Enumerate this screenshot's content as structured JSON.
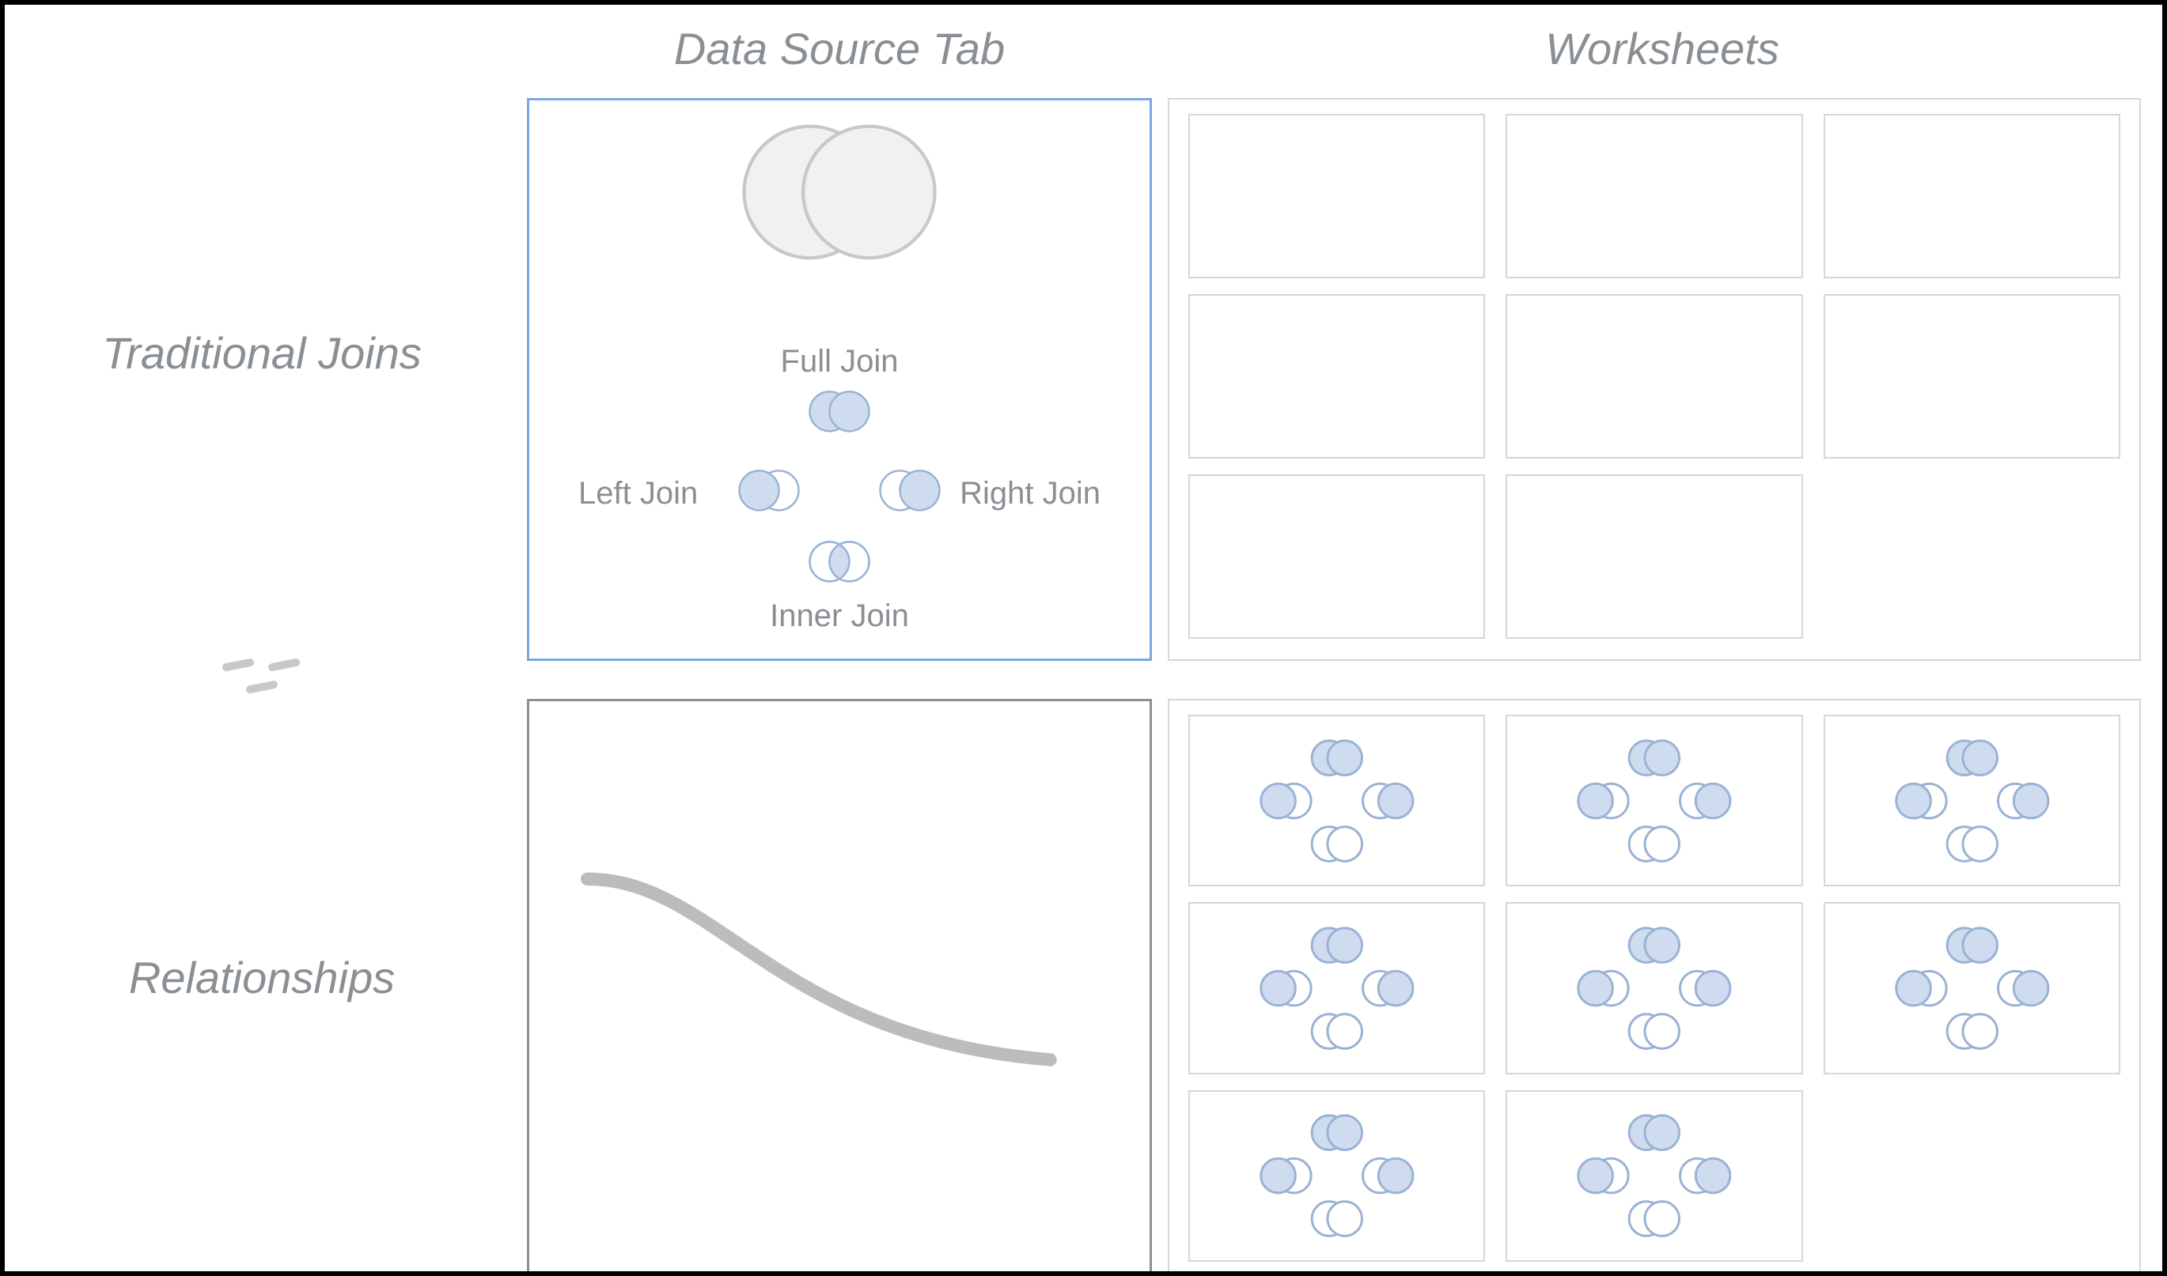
{
  "headers": {
    "data_source": "Data Source Tab",
    "worksheets": "Worksheets"
  },
  "rows": {
    "traditional_joins": "Traditional Joins",
    "relationships": "Relationships"
  },
  "joins": {
    "full": "Full Join",
    "left": "Left Join",
    "right": "Right Join",
    "inner": "Inner Join"
  },
  "worksheet_grid": {
    "top_rows": 3,
    "top_cols": 3,
    "top_visible": [
      true,
      true,
      true,
      true,
      true,
      true,
      true,
      true,
      false
    ],
    "bottom_rows": 3,
    "bottom_cols": 3,
    "bottom_visible": [
      true,
      true,
      true,
      true,
      true,
      true,
      true,
      true,
      false
    ]
  },
  "colors": {
    "text": "#8a8f94",
    "accent_blue_border": "#7aa9e0",
    "venn_fill": "#cfdcef",
    "venn_stroke": "#9ab3d4",
    "light_border": "#d6d6d6",
    "dark_border": "#8f8f8f"
  }
}
